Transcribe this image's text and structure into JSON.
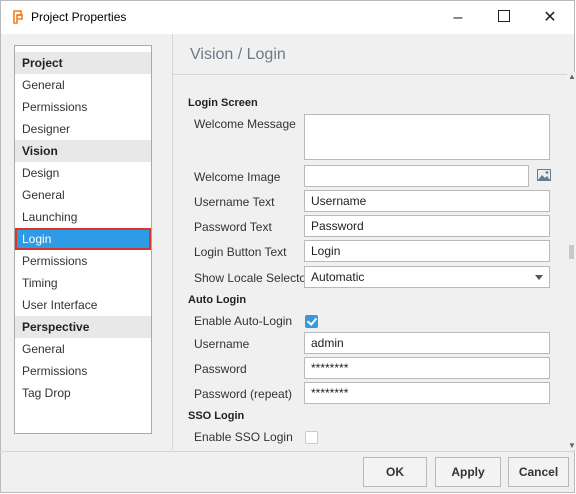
{
  "window": {
    "title": "Project Properties"
  },
  "sidebar": {
    "groups": [
      {
        "header": "Project",
        "items": [
          "General",
          "Permissions",
          "Designer"
        ]
      },
      {
        "header": "Vision",
        "items": [
          "Design",
          "General",
          "Launching",
          "Login",
          "Permissions",
          "Timing",
          "User Interface"
        ]
      },
      {
        "header": "Perspective",
        "items": [
          "General",
          "Permissions",
          "Tag Drop"
        ]
      }
    ],
    "selected": "Login"
  },
  "main": {
    "title": "Vision / Login",
    "login_screen": {
      "section": "Login Screen",
      "welcome_message_label": "Welcome Message",
      "welcome_message_value": "",
      "welcome_image_label": "Welcome Image",
      "welcome_image_value": "",
      "username_text_label": "Username Text",
      "username_text_value": "Username",
      "password_text_label": "Password Text",
      "password_text_value": "Password",
      "login_button_text_label": "Login Button Text",
      "login_button_text_value": "Login",
      "show_locale_selector_label": "Show Locale Selector",
      "show_locale_selector_value": "Automatic"
    },
    "auto_login": {
      "section": "Auto Login",
      "enable_label": "Enable Auto-Login",
      "enable_checked": true,
      "username_label": "Username",
      "username_value": "admin",
      "password_label": "Password",
      "password_value": "********",
      "password_repeat_label": "Password (repeat)",
      "password_repeat_value": "********"
    },
    "sso_login": {
      "section": "SSO Login",
      "enable_label": "Enable SSO Login",
      "enable_checked": false
    }
  },
  "footer": {
    "ok": "OK",
    "apply": "Apply",
    "cancel": "Cancel"
  },
  "colors": {
    "selection": "#2e9be6",
    "highlight_outline": "#d9342b",
    "checkbox_on": "#3a9ad9"
  },
  "icons": {
    "app": "project-properties-icon",
    "image_picker": "image-picker-icon"
  }
}
